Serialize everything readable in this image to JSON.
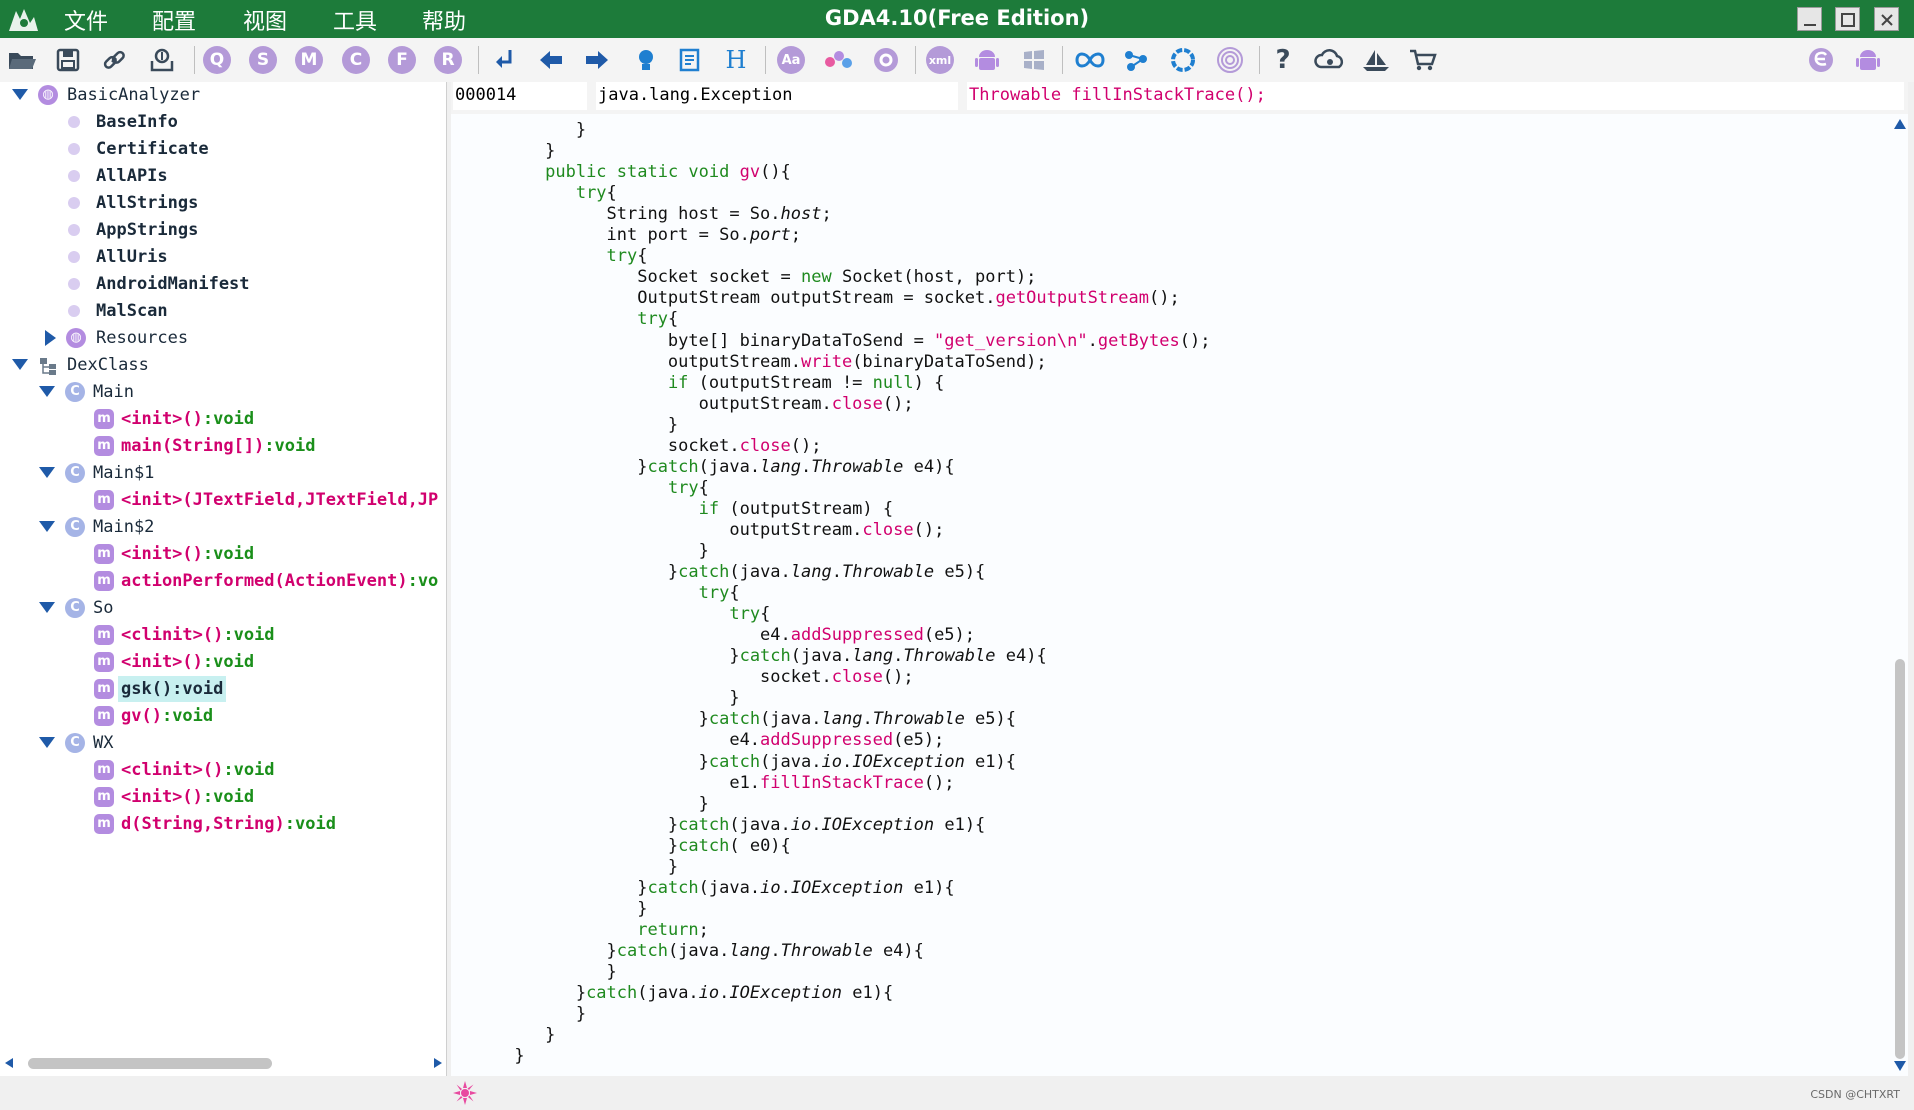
{
  "window": {
    "title": "GDA4.10(Free Edition)",
    "accent_color": "#1d7b3a"
  },
  "menu": [
    {
      "label": "文件"
    },
    {
      "label": "配置"
    },
    {
      "label": "视图"
    },
    {
      "label": "工具"
    },
    {
      "label": "帮助"
    }
  ],
  "toolbar": {
    "letter_buttons": [
      "Q",
      "S",
      "M",
      "C",
      "F",
      "R"
    ],
    "text_buttons": {
      "h": "H",
      "aa": "Aa",
      "xml": "xml"
    },
    "icons": [
      "open-folder-icon",
      "save-icon",
      "link-icon",
      "export-icon",
      "search-icon",
      "string-search-icon",
      "method-search-icon",
      "class-search-icon",
      "field-search-icon",
      "resource-search-icon",
      "goto-icon",
      "back-arrow-icon",
      "forward-arrow-icon",
      "bulb-icon",
      "report-icon",
      "hex-icon",
      "font-icon",
      "graph-icon",
      "settings-icon",
      "xml-icon",
      "android-icon",
      "windows-icon",
      "infinity-icon",
      "share-icon",
      "circle-icon",
      "fingerprint-icon",
      "help-icon",
      "cloud-icon",
      "ship-icon",
      "cart-icon",
      "e-icon",
      "android-right-icon"
    ]
  },
  "tree": {
    "root": {
      "label": "BasicAnalyzer"
    },
    "analyzer_items": [
      "BaseInfo",
      "Certificate",
      "AllAPIs",
      "AllStrings",
      "AppStrings",
      "AllUris",
      "AndroidManifest",
      "MalScan"
    ],
    "resources": {
      "label": "Resources"
    },
    "dexclass": {
      "label": "DexClass"
    },
    "classes": [
      {
        "name": "Main",
        "methods": [
          {
            "name": "<init>()",
            "ret": ":void"
          },
          {
            "name": "main(String[])",
            "ret": ":void"
          }
        ]
      },
      {
        "name": "Main$1",
        "methods": [
          {
            "name": "<init>(JTextField,JTextField,JP",
            "ret": ""
          }
        ]
      },
      {
        "name": "Main$2",
        "methods": [
          {
            "name": "<init>()",
            "ret": ":void"
          },
          {
            "name": "actionPerformed(ActionEvent)",
            "ret": ":vo"
          }
        ]
      },
      {
        "name": "So",
        "methods": [
          {
            "name": "<clinit>()",
            "ret": ":void"
          },
          {
            "name": "<init>()",
            "ret": ":void"
          },
          {
            "name": "gsk():void",
            "ret": "",
            "selected": true
          },
          {
            "name": "gv()",
            "ret": ":void"
          }
        ]
      },
      {
        "name": "WX",
        "methods": [
          {
            "name": "<clinit>()",
            "ret": ":void"
          },
          {
            "name": "<init>()",
            "ret": ":void"
          },
          {
            "name": "d(String,String)",
            "ret": ":void"
          }
        ]
      }
    ]
  },
  "code_header": {
    "offset": "000014",
    "type": "java.lang.Exception",
    "call": "Throwable fillInStackTrace();"
  },
  "code_lines": [
    [
      {
        "t": "            }",
        "c": ""
      }
    ],
    [
      {
        "t": "         }",
        "c": ""
      }
    ],
    [
      {
        "t": "         ",
        "c": ""
      },
      {
        "t": "public static void ",
        "c": "kw"
      },
      {
        "t": "gv",
        "c": "mc"
      },
      {
        "t": "(){",
        "c": ""
      }
    ],
    [
      {
        "t": "            ",
        "c": ""
      },
      {
        "t": "try",
        "c": "kw"
      },
      {
        "t": "{",
        "c": ""
      }
    ],
    [
      {
        "t": "               String host = So.",
        "c": ""
      },
      {
        "t": "host",
        "c": "it"
      },
      {
        "t": ";",
        "c": ""
      }
    ],
    [
      {
        "t": "               int port = So.",
        "c": ""
      },
      {
        "t": "port",
        "c": "it"
      },
      {
        "t": ";",
        "c": ""
      }
    ],
    [
      {
        "t": "               ",
        "c": ""
      },
      {
        "t": "try",
        "c": "kw"
      },
      {
        "t": "{",
        "c": ""
      }
    ],
    [
      {
        "t": "                  Socket socket = ",
        "c": ""
      },
      {
        "t": "new",
        "c": "kw"
      },
      {
        "t": " Socket(host, port);",
        "c": ""
      }
    ],
    [
      {
        "t": "                  OutputStream outputStream = socket.",
        "c": ""
      },
      {
        "t": "getOutputStream",
        "c": "mc"
      },
      {
        "t": "();",
        "c": ""
      }
    ],
    [
      {
        "t": "                  ",
        "c": ""
      },
      {
        "t": "try",
        "c": "kw"
      },
      {
        "t": "{",
        "c": ""
      }
    ],
    [
      {
        "t": "                     byte[] binaryDataToSend = ",
        "c": ""
      },
      {
        "t": "\"get_version\\n\"",
        "c": "str"
      },
      {
        "t": ".",
        "c": ""
      },
      {
        "t": "getBytes",
        "c": "mc"
      },
      {
        "t": "();",
        "c": ""
      }
    ],
    [
      {
        "t": "                     outputStream.",
        "c": ""
      },
      {
        "t": "write",
        "c": "mc"
      },
      {
        "t": "(binaryDataToSend);",
        "c": ""
      }
    ],
    [
      {
        "t": "                     ",
        "c": ""
      },
      {
        "t": "if",
        "c": "kw"
      },
      {
        "t": " (outputStream != ",
        "c": ""
      },
      {
        "t": "null",
        "c": "kw"
      },
      {
        "t": ") {",
        "c": ""
      }
    ],
    [
      {
        "t": "                        outputStream.",
        "c": ""
      },
      {
        "t": "close",
        "c": "mc"
      },
      {
        "t": "();",
        "c": ""
      }
    ],
    [
      {
        "t": "                     }",
        "c": ""
      }
    ],
    [
      {
        "t": "                     socket.",
        "c": ""
      },
      {
        "t": "close",
        "c": "mc"
      },
      {
        "t": "();",
        "c": ""
      }
    ],
    [
      {
        "t": "                  }",
        "c": ""
      },
      {
        "t": "catch",
        "c": "kw"
      },
      {
        "t": "(java.",
        "c": ""
      },
      {
        "t": "lang",
        "c": "it"
      },
      {
        "t": ".",
        "c": ""
      },
      {
        "t": "Throwable",
        "c": "it"
      },
      {
        "t": " e4){",
        "c": ""
      }
    ],
    [
      {
        "t": "                     ",
        "c": ""
      },
      {
        "t": "try",
        "c": "kw"
      },
      {
        "t": "{",
        "c": ""
      }
    ],
    [
      {
        "t": "                        ",
        "c": ""
      },
      {
        "t": "if",
        "c": "kw"
      },
      {
        "t": " (outputStream) {",
        "c": ""
      }
    ],
    [
      {
        "t": "                           outputStream.",
        "c": ""
      },
      {
        "t": "close",
        "c": "mc"
      },
      {
        "t": "();",
        "c": ""
      }
    ],
    [
      {
        "t": "                        }",
        "c": ""
      }
    ],
    [
      {
        "t": "                     }",
        "c": ""
      },
      {
        "t": "catch",
        "c": "kw"
      },
      {
        "t": "(java.",
        "c": ""
      },
      {
        "t": "lang",
        "c": "it"
      },
      {
        "t": ".",
        "c": ""
      },
      {
        "t": "Throwable",
        "c": "it"
      },
      {
        "t": " e5){",
        "c": ""
      }
    ],
    [
      {
        "t": "                        ",
        "c": ""
      },
      {
        "t": "try",
        "c": "kw"
      },
      {
        "t": "{",
        "c": ""
      }
    ],
    [
      {
        "t": "                           ",
        "c": ""
      },
      {
        "t": "try",
        "c": "kw"
      },
      {
        "t": "{",
        "c": ""
      }
    ],
    [
      {
        "t": "                              e4.",
        "c": ""
      },
      {
        "t": "addSuppressed",
        "c": "mc"
      },
      {
        "t": "(e5);",
        "c": ""
      }
    ],
    [
      {
        "t": "                           }",
        "c": ""
      },
      {
        "t": "catch",
        "c": "kw"
      },
      {
        "t": "(java.",
        "c": ""
      },
      {
        "t": "lang",
        "c": "it"
      },
      {
        "t": ".",
        "c": ""
      },
      {
        "t": "Throwable",
        "c": "it"
      },
      {
        "t": " e4){",
        "c": ""
      }
    ],
    [
      {
        "t": "                              socket.",
        "c": ""
      },
      {
        "t": "close",
        "c": "mc"
      },
      {
        "t": "();",
        "c": ""
      }
    ],
    [
      {
        "t": "                           }",
        "c": ""
      }
    ],
    [
      {
        "t": "                        }",
        "c": ""
      },
      {
        "t": "catch",
        "c": "kw"
      },
      {
        "t": "(java.",
        "c": ""
      },
      {
        "t": "lang",
        "c": "it"
      },
      {
        "t": ".",
        "c": ""
      },
      {
        "t": "Throwable",
        "c": "it"
      },
      {
        "t": " e5){",
        "c": ""
      }
    ],
    [
      {
        "t": "                           e4.",
        "c": ""
      },
      {
        "t": "addSuppressed",
        "c": "mc"
      },
      {
        "t": "(e5);",
        "c": ""
      }
    ],
    [
      {
        "t": "                        }",
        "c": ""
      },
      {
        "t": "catch",
        "c": "kw"
      },
      {
        "t": "(java.",
        "c": ""
      },
      {
        "t": "io",
        "c": "it"
      },
      {
        "t": ".",
        "c": ""
      },
      {
        "t": "IOException",
        "c": "it"
      },
      {
        "t": " e1){",
        "c": ""
      }
    ],
    [
      {
        "t": "                           e1.",
        "c": ""
      },
      {
        "t": "fillInStackTrace",
        "c": "mc"
      },
      {
        "t": "();",
        "c": ""
      }
    ],
    [
      {
        "t": "                        }",
        "c": ""
      }
    ],
    [
      {
        "t": "                     }",
        "c": ""
      },
      {
        "t": "catch",
        "c": "kw"
      },
      {
        "t": "(java.",
        "c": ""
      },
      {
        "t": "io",
        "c": "it"
      },
      {
        "t": ".",
        "c": ""
      },
      {
        "t": "IOException",
        "c": "it"
      },
      {
        "t": " e1){",
        "c": ""
      }
    ],
    [
      {
        "t": "                     }",
        "c": ""
      },
      {
        "t": "catch",
        "c": "kw"
      },
      {
        "t": "( e0){",
        "c": ""
      }
    ],
    [
      {
        "t": "                     }",
        "c": ""
      }
    ],
    [
      {
        "t": "                  }",
        "c": ""
      },
      {
        "t": "catch",
        "c": "kw"
      },
      {
        "t": "(java.",
        "c": ""
      },
      {
        "t": "io",
        "c": "it"
      },
      {
        "t": ".",
        "c": ""
      },
      {
        "t": "IOException",
        "c": "it"
      },
      {
        "t": " e1){",
        "c": ""
      }
    ],
    [
      {
        "t": "                  }",
        "c": ""
      }
    ],
    [
      {
        "t": "                  ",
        "c": ""
      },
      {
        "t": "return",
        "c": "kw"
      },
      {
        "t": ";",
        "c": ""
      }
    ],
    [
      {
        "t": "               }",
        "c": ""
      },
      {
        "t": "catch",
        "c": "kw"
      },
      {
        "t": "(java.",
        "c": ""
      },
      {
        "t": "lang",
        "c": "it"
      },
      {
        "t": ".",
        "c": ""
      },
      {
        "t": "Throwable",
        "c": "it"
      },
      {
        "t": " e4){",
        "c": ""
      }
    ],
    [
      {
        "t": "               }",
        "c": ""
      }
    ],
    [
      {
        "t": "            }",
        "c": ""
      },
      {
        "t": "catch",
        "c": "kw"
      },
      {
        "t": "(java.",
        "c": ""
      },
      {
        "t": "io",
        "c": "it"
      },
      {
        "t": ".",
        "c": ""
      },
      {
        "t": "IOException",
        "c": "it"
      },
      {
        "t": " e1){",
        "c": ""
      }
    ],
    [
      {
        "t": "            }",
        "c": ""
      }
    ],
    [
      {
        "t": "         }",
        "c": ""
      }
    ],
    [
      {
        "t": "      }",
        "c": ""
      }
    ]
  ],
  "status": {
    "watermark": "CSDN @CHTXRT"
  }
}
